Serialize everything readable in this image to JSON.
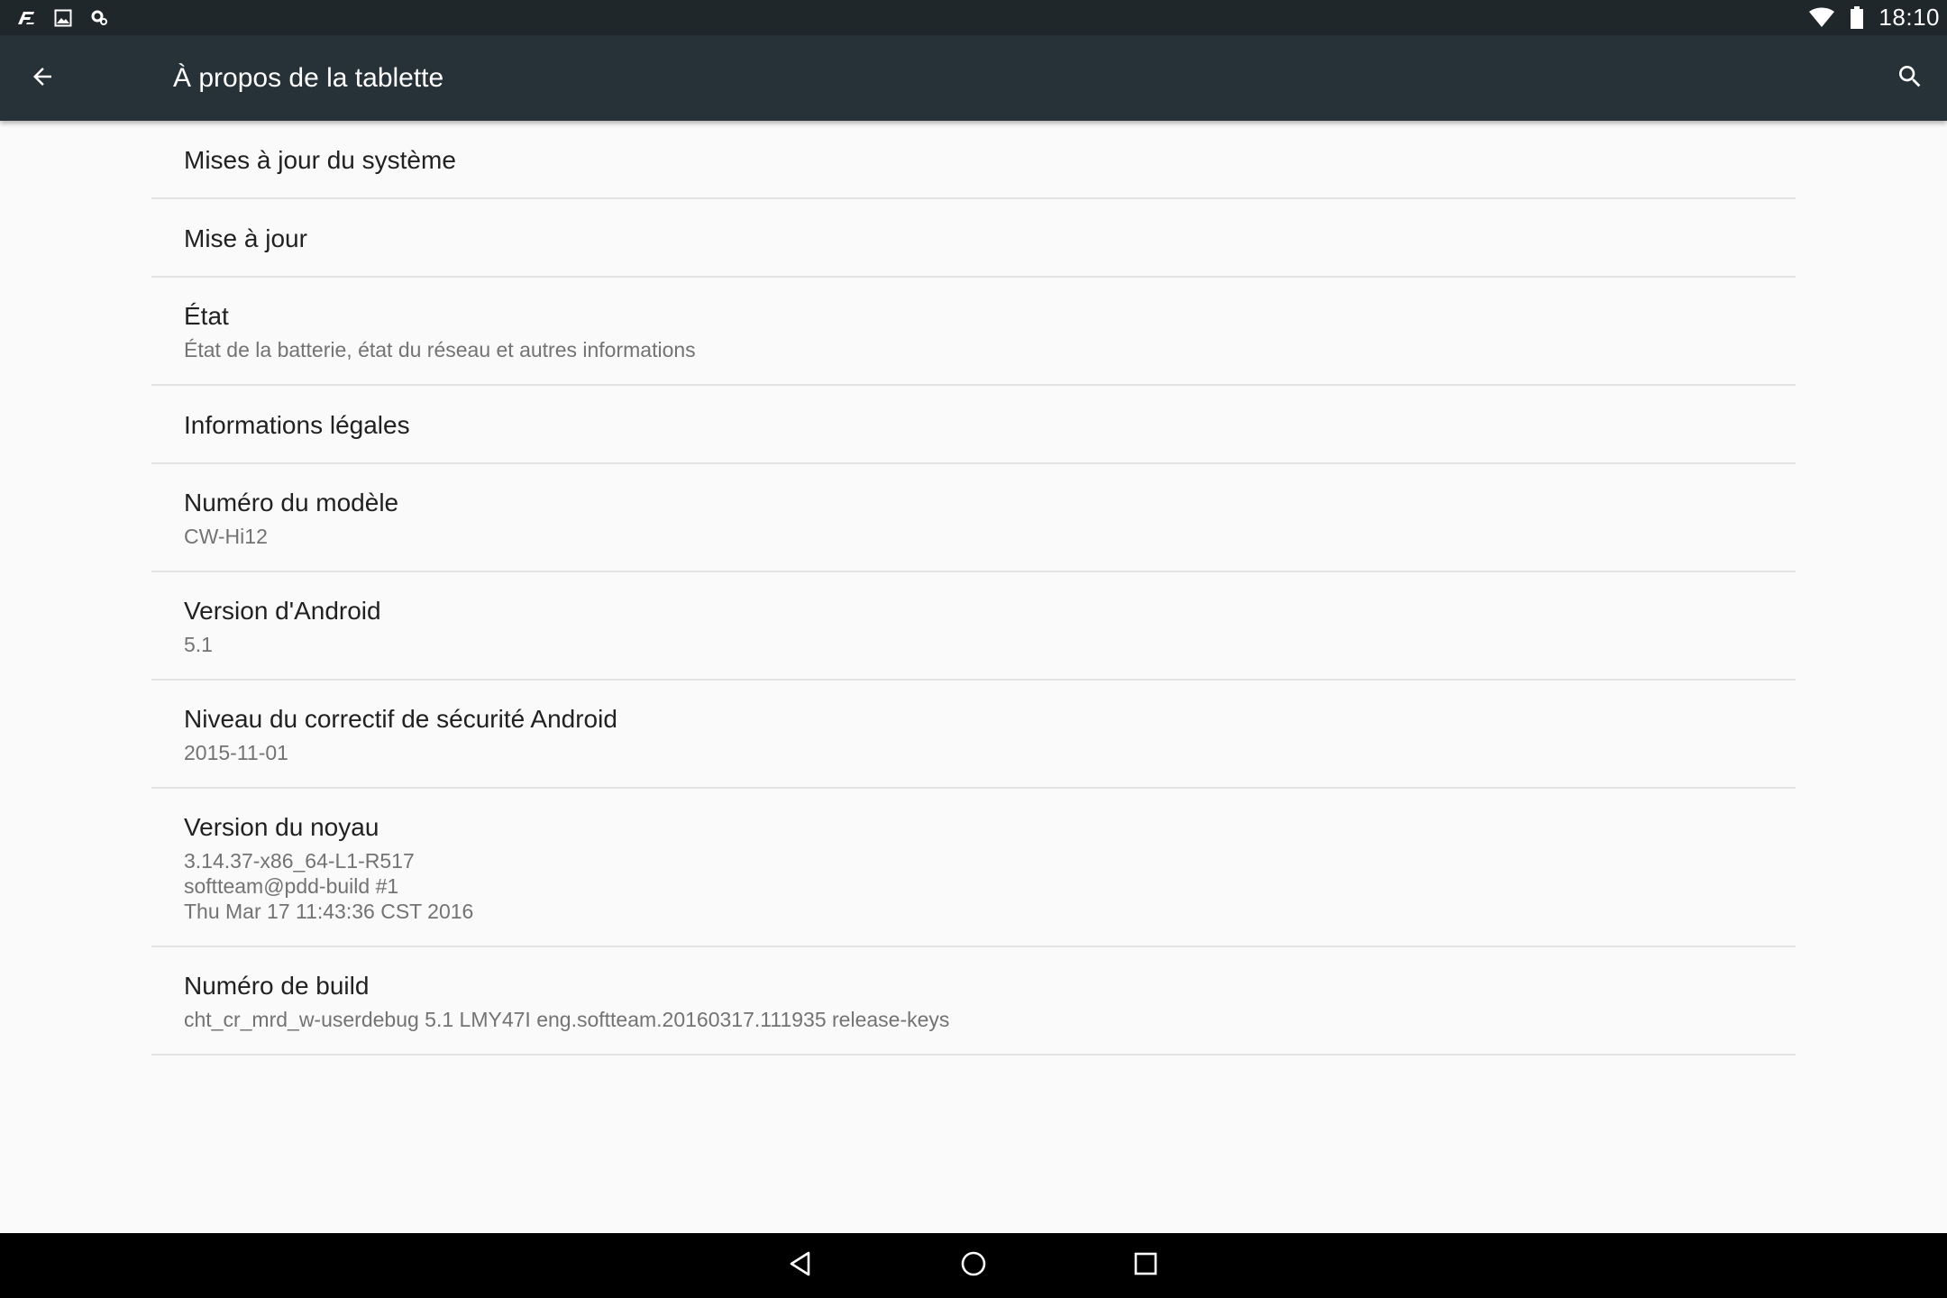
{
  "status_bar": {
    "time": "18:10",
    "left_icons": [
      "app-notification-icon",
      "image-notification-icon",
      "settings-notification-icon"
    ],
    "right_icons": [
      "wifi-icon",
      "battery-icon"
    ]
  },
  "toolbar": {
    "title": "À propos de la tablette",
    "back_icon": "arrow-back-icon",
    "search_icon": "search-icon",
    "background": "#263238"
  },
  "preferences": [
    {
      "title": "Mises à jour du système",
      "summary": ""
    },
    {
      "title": "Mise à jour",
      "summary": ""
    },
    {
      "title": "État",
      "summary": "État de la batterie, état du réseau et autres informations"
    },
    {
      "title": "Informations légales",
      "summary": ""
    },
    {
      "title": "Numéro du modèle",
      "summary": "CW-Hi12"
    },
    {
      "title": "Version d'Android",
      "summary": "5.1"
    },
    {
      "title": "Niveau du correctif de sécurité Android",
      "summary": "2015-11-01"
    },
    {
      "title": "Version du noyau",
      "summary": "3.14.37-x86_64-L1-R517\nsoftteam@pdd-build #1\nThu Mar 17 11:43:36 CST 2016"
    },
    {
      "title": "Numéro de build",
      "summary": "cht_cr_mrd_w-userdebug 5.1 LMY47I eng.softteam.20160317.111935 release-keys"
    }
  ],
  "nav_bar": {
    "buttons": [
      "back-nav-icon",
      "home-nav-icon",
      "recents-nav-icon"
    ]
  }
}
